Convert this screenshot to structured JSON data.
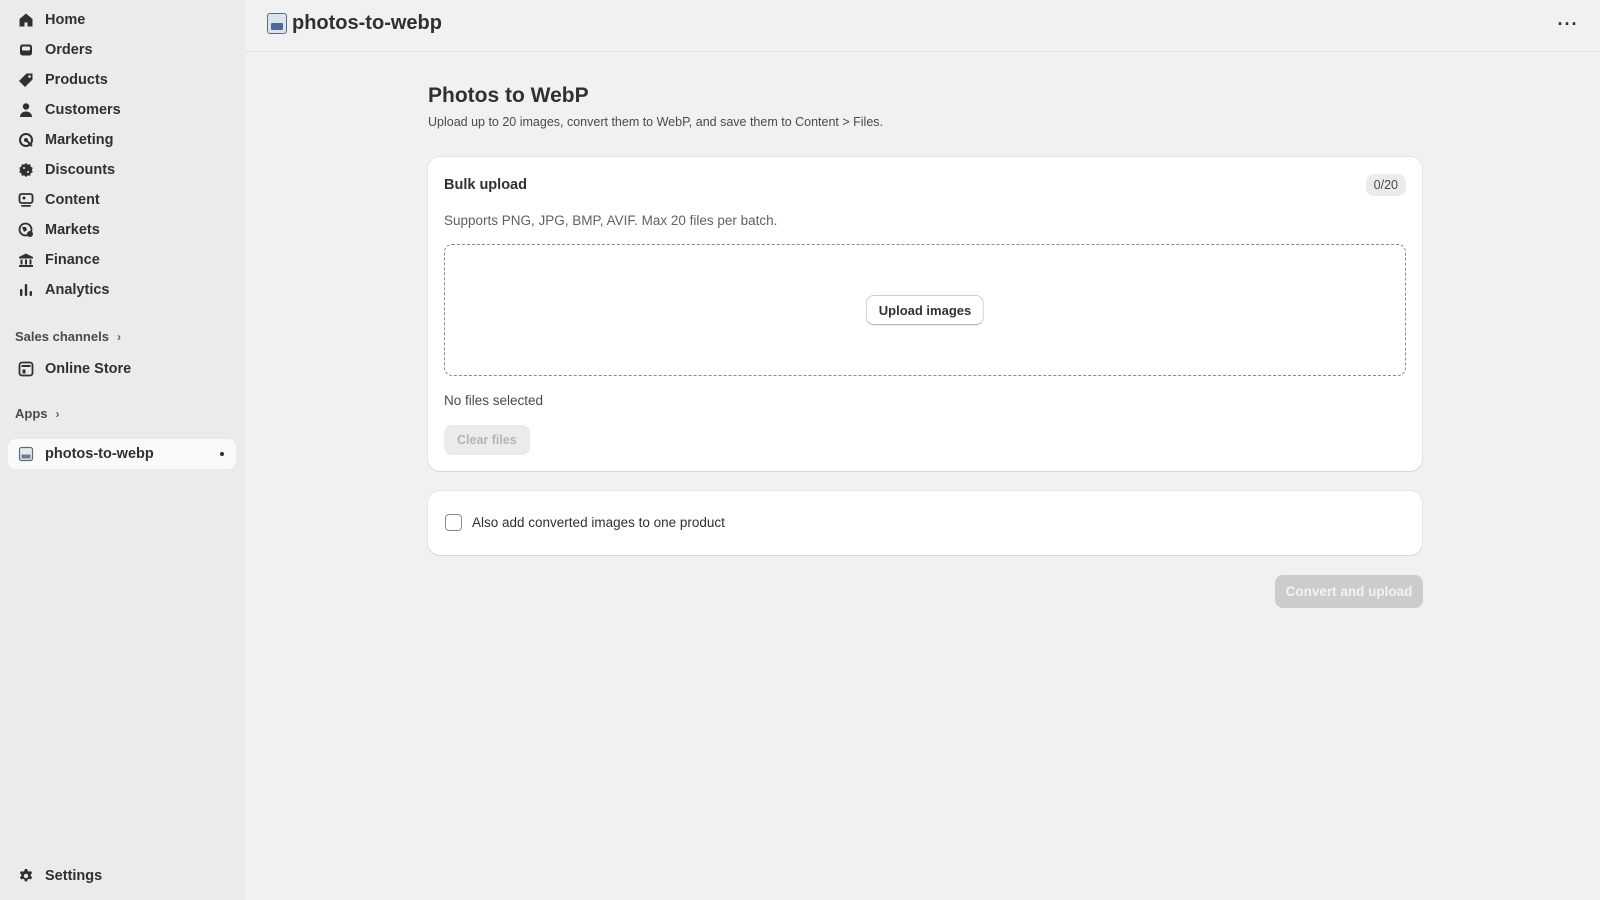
{
  "sidebar": {
    "nav": [
      {
        "label": "Home",
        "icon": "home-icon"
      },
      {
        "label": "Orders",
        "icon": "inbox-icon"
      },
      {
        "label": "Products",
        "icon": "tag-icon"
      },
      {
        "label": "Customers",
        "icon": "person-icon"
      },
      {
        "label": "Marketing",
        "icon": "target-icon"
      },
      {
        "label": "Discounts",
        "icon": "discount-icon"
      },
      {
        "label": "Content",
        "icon": "content-icon"
      },
      {
        "label": "Markets",
        "icon": "globe-icon"
      },
      {
        "label": "Finance",
        "icon": "bank-icon"
      },
      {
        "label": "Analytics",
        "icon": "bar-chart-icon"
      }
    ],
    "sales_channels_label": "Sales channels",
    "online_store_label": "Online Store",
    "apps_label": "Apps",
    "pinned_app_label": "photos-to-webp",
    "settings_label": "Settings"
  },
  "topbar": {
    "app_title": "photos-to-webp",
    "more_label": "···"
  },
  "main": {
    "title": "Photos to WebP",
    "subtitle": "Upload up to 20 images, convert them to WebP, and save them to Content > Files.",
    "upload_card": {
      "title": "Bulk upload",
      "count": "0/20",
      "help": "Supports PNG, JPG, BMP, AVIF. Max 20 files per batch.",
      "upload_button": "Upload images",
      "files_status": "No files selected",
      "clear_button": "Clear files"
    },
    "option_card": {
      "checkbox_label": "Also add converted images to one product",
      "checked": false
    },
    "convert_button": "Convert and upload"
  },
  "colors": {
    "sidebar_bg": "#ebebeb",
    "page_bg": "#f1f1f1",
    "card_bg": "#ffffff",
    "disabled_button": "#cccccc",
    "text": "#303030"
  }
}
